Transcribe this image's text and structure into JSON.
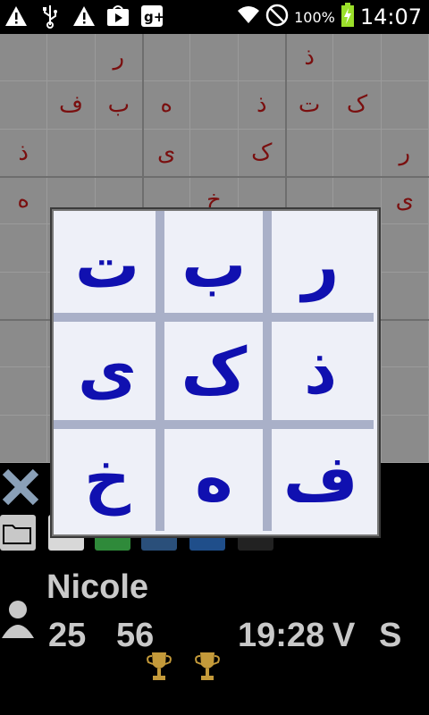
{
  "status": {
    "battery": "100%",
    "time": "14:07",
    "icons": [
      "warning-icon",
      "usb-icon",
      "warning-icon",
      "play-store-icon",
      "google-plus-icon"
    ]
  },
  "board": {
    "cells": [
      {
        "r": 0,
        "c": 2,
        "v": "ر"
      },
      {
        "r": 0,
        "c": 6,
        "v": "ذ"
      },
      {
        "r": 1,
        "c": 1,
        "v": "ف"
      },
      {
        "r": 1,
        "c": 2,
        "v": "ب"
      },
      {
        "r": 1,
        "c": 3,
        "v": "ه"
      },
      {
        "r": 1,
        "c": 5,
        "v": "ذ"
      },
      {
        "r": 1,
        "c": 6,
        "v": "ت"
      },
      {
        "r": 1,
        "c": 7,
        "v": "ک"
      },
      {
        "r": 2,
        "c": 0,
        "v": "ذ"
      },
      {
        "r": 2,
        "c": 3,
        "v": "ی"
      },
      {
        "r": 2,
        "c": 5,
        "v": "ک"
      },
      {
        "r": 2,
        "c": 8,
        "v": "ر"
      },
      {
        "r": 3,
        "c": 0,
        "v": "ه"
      },
      {
        "r": 3,
        "c": 4,
        "v": "خ"
      },
      {
        "r": 3,
        "c": 8,
        "v": "ی"
      }
    ]
  },
  "picker": {
    "letters": [
      [
        "ت",
        "ب",
        "ر"
      ],
      [
        "ی",
        "ک",
        "ذ"
      ],
      [
        "خ",
        "ه",
        "ف"
      ]
    ]
  },
  "player": {
    "name": "Nicole",
    "score1": "25",
    "score2": "56",
    "time": "19:28",
    "v_label": "V",
    "s_label": "S"
  }
}
